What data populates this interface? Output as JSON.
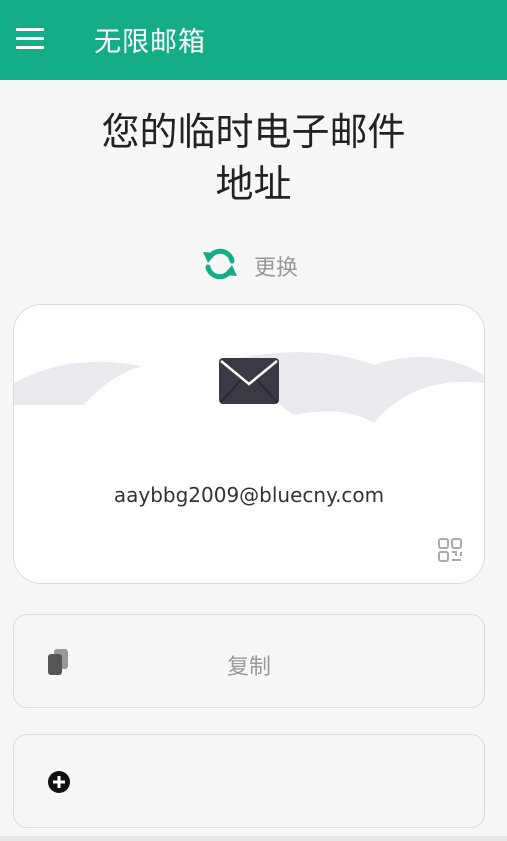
{
  "appbar": {
    "title": "无限邮箱",
    "menu_icon": "hamburger-menu-icon",
    "color": "#14ad85"
  },
  "heading": {
    "line1": "您的临时电子邮件",
    "line2": "地址"
  },
  "refresh": {
    "label": "更换",
    "icon": "refresh-icon",
    "color": "#14ad85"
  },
  "email_card": {
    "address": "aaybbg2009@bluecny.com",
    "envelope_icon": "envelope-icon",
    "qr_icon": "qr-code-icon"
  },
  "copy_button": {
    "label": "复制",
    "icon": "copy-icon"
  },
  "add_button": {
    "icon": "plus-circle-icon"
  }
}
